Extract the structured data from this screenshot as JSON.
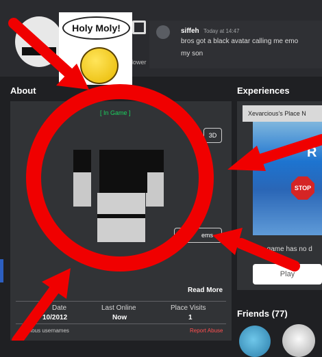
{
  "meme": {
    "bubble_text": "Holy Moly!"
  },
  "header": {
    "follow_icon": "square-spiral-icon",
    "partial_text": "lower",
    "comment": {
      "user": "siffeh",
      "time": "Today at 14:47",
      "line1": "bros got a black avatar calling me emo",
      "line2": "my son"
    }
  },
  "about": {
    "title": "About",
    "status": "[ In Game ]",
    "view_toggle": "3D",
    "shop_label_left": "Sh",
    "shop_label_right": "ems",
    "read_more": "Read More",
    "stats": [
      {
        "label": "Date",
        "value": "10/2012"
      },
      {
        "label": "Last Online",
        "value": "Now"
      },
      {
        "label": "Place Visits",
        "value": "1"
      }
    ],
    "previous_usernames": "Previous usernames",
    "report": "Report Abuse"
  },
  "experiences": {
    "title": "Experiences",
    "tab_label": "Xevarcious's Place N",
    "art_letter": "R",
    "stop_text": "STOP",
    "desc": "This game has no d",
    "play": "Play"
  },
  "friends": {
    "title": "Friends (77)"
  },
  "colors": {
    "overlay_red": "#f00000",
    "status_green": "#1bd15f",
    "report_red": "#ff4f4f"
  }
}
